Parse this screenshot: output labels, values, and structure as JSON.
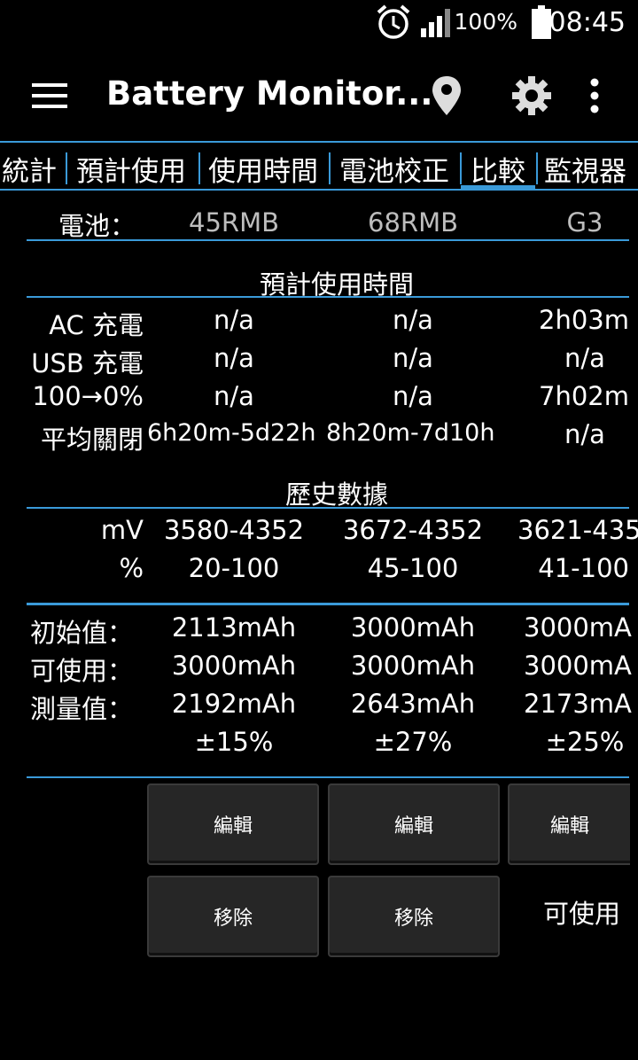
{
  "status": {
    "time": "08:45",
    "battery_pct": "100%"
  },
  "app": {
    "title": "Battery Monitor..."
  },
  "tabs": [
    "統計",
    "預計使用",
    "使用時間",
    "電池校正",
    "比較",
    "監視器"
  ],
  "colors": {
    "accent": "#3a9ad9",
    "background": "#000000",
    "button": "#262626"
  },
  "battery_header": {
    "label": "電池：",
    "cols": [
      "45RMB",
      "68RMB",
      "G3"
    ]
  },
  "estimate": {
    "title": "預計使用時間",
    "rows": [
      {
        "label": "AC 充電",
        "values": [
          "n/a",
          "n/a",
          "2h03m"
        ]
      },
      {
        "label": "USB 充電",
        "values": [
          "n/a",
          "n/a",
          "n/a"
        ]
      },
      {
        "label": "100→0%",
        "values": [
          "n/a",
          "n/a",
          "7h02m"
        ]
      },
      {
        "label": "平均關閉",
        "values": [
          "6h20m-5d22h",
          "8h20m-7d10h",
          "n/a"
        ]
      }
    ]
  },
  "history": {
    "title": "歷史數據",
    "rows": [
      {
        "label": "mV",
        "values": [
          "3580-4352",
          "3672-4352",
          "3621-435"
        ]
      },
      {
        "label": "%",
        "values": [
          "20-100",
          "45-100",
          "41-100"
        ]
      }
    ]
  },
  "capacity": {
    "rows": [
      {
        "label": "初始值：",
        "values": [
          "2113mAh",
          "3000mAh",
          "3000mA"
        ]
      },
      {
        "label": "可使用：",
        "values": [
          "3000mAh",
          "3000mAh",
          "3000mA"
        ]
      },
      {
        "label": "測量值：",
        "values": [
          "2192mAh",
          "2643mAh",
          "2173mA"
        ]
      },
      {
        "label": "",
        "values": [
          "±15%",
          "±27%",
          "±25%"
        ]
      }
    ]
  },
  "buttons": {
    "edit": "編輯",
    "remove": "移除",
    "usable_label": "可使用"
  }
}
